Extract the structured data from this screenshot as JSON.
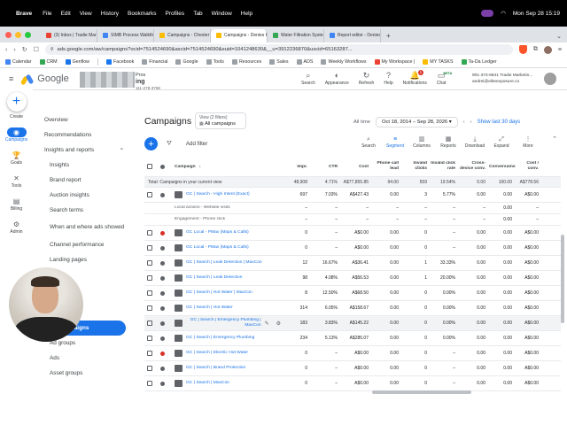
{
  "menubar": {
    "app": "Brave",
    "items": [
      "File",
      "Edit",
      "View",
      "History",
      "Bookmarks",
      "Profiles",
      "Tab",
      "Window",
      "Help"
    ],
    "clock": "Mon Sep 28  15:19"
  },
  "tabs": [
    {
      "label": "(3) Inbox | Tradie Marketing"
    },
    {
      "label": "SIMB Process Walkthrough"
    },
    {
      "label": "Campaigns - Chester Plumbing"
    },
    {
      "label": "Campaigns - Denies Plumbing"
    },
    {
      "label": "Water Filtration Systems Gold"
    },
    {
      "label": "Report editor - Denies Plumb"
    }
  ],
  "address": {
    "url": "ads.google.com/aw/campaigns?ocid=7514524690&ascid=7514524690&euid=1041248630&__u=3912236870&uscid=65163287..."
  },
  "bookmarks": [
    {
      "label": "Calendar",
      "color": "#4285f4"
    },
    {
      "label": "CRM",
      "color": "#34a853"
    },
    {
      "label": "Genflow",
      "color": "#1a73e8"
    },
    {
      "label": "Facebook",
      "color": "#1877f2"
    },
    {
      "label": "Financial",
      "color": "#9aa0a6"
    },
    {
      "label": "Google",
      "color": "#9aa0a6"
    },
    {
      "label": "Tools",
      "color": "#9aa0a6"
    },
    {
      "label": "Resources",
      "color": "#9aa0a6"
    },
    {
      "label": "Sales",
      "color": "#9aa0a6"
    },
    {
      "label": "ADS",
      "color": "#9aa0a6"
    },
    {
      "label": "Weekly Workflows",
      "color": "#9aa0a6"
    },
    {
      "label": "My Workspace |",
      "color": "#ea4335"
    },
    {
      "label": "MY TASKS",
      "color": "#fbbc04"
    },
    {
      "label": "Ta-Da Ledger",
      "color": "#34a853"
    }
  ],
  "header": {
    "brand": "Google",
    "account_line1": "Pros",
    "account_line2": "ing",
    "account_id": "111-278-3766",
    "tools": [
      {
        "label": "Search",
        "icon": "search-icon",
        "glyph": "⌕"
      },
      {
        "label": "Appearance",
        "icon": "appearance-icon",
        "glyph": "◐"
      },
      {
        "label": "Refresh",
        "icon": "refresh-icon",
        "glyph": "↻"
      },
      {
        "label": "Help",
        "icon": "help-icon",
        "glyph": "?"
      },
      {
        "label": "Notifications",
        "icon": "bell-icon",
        "glyph": "🔔",
        "badge": "1"
      },
      {
        "label": "Chat",
        "icon": "chat-icon",
        "glyph": "▭",
        "beta": "BETA"
      }
    ],
    "user_phone": "901-373-6841 Tradie Marketin...",
    "user_email": "andrei@eliteexposure.co"
  },
  "rail": [
    {
      "label": "Create",
      "glyph": "+"
    },
    {
      "label": "Campaigns",
      "glyph": "◉"
    },
    {
      "label": "Goals",
      "glyph": "🏆"
    },
    {
      "label": "Tools",
      "glyph": "✕"
    },
    {
      "label": "Billing",
      "glyph": "▤"
    },
    {
      "label": "Admin",
      "glyph": "⚙"
    }
  ],
  "nav": {
    "overview": "Overview",
    "recommendations": "Recommendations",
    "insights_group": "Insights and reports",
    "insights": "Insights",
    "brand_report": "Brand report",
    "auction_insights": "Auction insights",
    "search_terms": "Search terms",
    "when_where": "When and where ads showed",
    "channel_perf": "Channel performance",
    "landing_pages": "Landing pages",
    "campaigns_sel": "Campaigns",
    "ad_groups": "Ad groups",
    "ads": "Ads",
    "asset_groups": "Asset groups"
  },
  "main": {
    "title": "Campaigns",
    "view_filters": "View (2 filters)",
    "view_name": "All campaigns",
    "all_time": "All time",
    "date_range": "Oct 18, 2014 – Sep 28, 2026",
    "show_last": "Show last 30 days",
    "add_filter": "Add filter",
    "tools": [
      {
        "label": "Search",
        "glyph": "⌕"
      },
      {
        "label": "Segment",
        "glyph": "≡",
        "active": true
      },
      {
        "label": "Columns",
        "glyph": "▥"
      },
      {
        "label": "Reports",
        "glyph": "▦"
      },
      {
        "label": "Download",
        "glyph": "⤓"
      },
      {
        "label": "Expand",
        "glyph": "⤢"
      },
      {
        "label": "More",
        "glyph": "⋮"
      }
    ]
  },
  "table": {
    "headers": {
      "campaign": "Campaign",
      "impr": "Impr.",
      "ctr": "CTR",
      "cost": "Cost",
      "phone": "Phone call lead",
      "invalid": "Invalid clicks",
      "invalid_rate": "Invalid click rate",
      "cross": "Cross-device conv.",
      "conversions": "Conversions",
      "cost_conv": "Cost / conv."
    },
    "total": {
      "label": "Total: Campaigns in your current view",
      "impr": "48,908",
      "ctr": "4.71%",
      "cost": "A$77,855.85",
      "phone": "94.00",
      "invalid": "559",
      "invalid_rate": "19.54%",
      "cross": "0.00",
      "conversions": "100.00",
      "cost_conv": "A$778.56"
    },
    "rows": [
      {
        "name": "GC | Search - High Intent (Exact)",
        "status": "grey",
        "impr": "697",
        "ctr": "7.03%",
        "cost": "A$427.43",
        "phone": "0.00",
        "invalid": "3",
        "invalid_rate": "5.77%",
        "cross": "0.00",
        "conversions": "0.00",
        "cost_conv": "A$0.00"
      },
      {
        "name": "Local actions - Website visits",
        "sub": true,
        "impr": "–",
        "ctr": "–",
        "cost": "–",
        "phone": "–",
        "invalid": "–",
        "invalid_rate": "–",
        "cross": "–",
        "conversions": "0.00",
        "cost_conv": "–"
      },
      {
        "name": "Engagement - Phone click",
        "sub": true,
        "impr": "–",
        "ctr": "–",
        "cost": "–",
        "phone": "–",
        "invalid": "–",
        "invalid_rate": "–",
        "cross": "–",
        "conversions": "0.00",
        "cost_conv": "–"
      },
      {
        "name": "GC Local - PMax (Maps & Calls)",
        "status": "red",
        "impr": "0",
        "ctr": "–",
        "cost": "A$0.00",
        "phone": "0.00",
        "invalid": "0",
        "invalid_rate": "–",
        "cross": "0.00",
        "conversions": "0.00",
        "cost_conv": "A$0.00"
      },
      {
        "name": "GC Local - PMax (Maps & Calls)",
        "status": "grey",
        "impr": "0",
        "ctr": "–",
        "cost": "A$0.00",
        "phone": "0.00",
        "invalid": "0",
        "invalid_rate": "–",
        "cross": "0.00",
        "conversions": "0.00",
        "cost_conv": "A$0.00"
      },
      {
        "name": "GC | Search | Leak Detection | MaxCon",
        "status": "grey",
        "impr": "12",
        "ctr": "16.67%",
        "cost": "A$36.41",
        "phone": "0.00",
        "invalid": "1",
        "invalid_rate": "33.33%",
        "cross": "0.00",
        "conversions": "0.00",
        "cost_conv": "A$0.00"
      },
      {
        "name": "GC | Search | Leak Detection",
        "status": "grey",
        "impr": "98",
        "ctr": "4.08%",
        "cost": "A$56.53",
        "phone": "0.00",
        "invalid": "1",
        "invalid_rate": "20.00%",
        "cross": "0.00",
        "conversions": "0.00",
        "cost_conv": "A$0.00"
      },
      {
        "name": "GC | Search | Hot Water | MaxCon",
        "status": "grey",
        "impr": "8",
        "ctr": "12.50%",
        "cost": "A$68.50",
        "phone": "0.00",
        "invalid": "0",
        "invalid_rate": "0.00%",
        "cross": "0.00",
        "conversions": "0.00",
        "cost_conv": "A$0.00"
      },
      {
        "name": "GC | Search | Hot Water",
        "status": "grey",
        "impr": "314",
        "ctr": "6.05%",
        "cost": "A$158.67",
        "phone": "0.00",
        "invalid": "0",
        "invalid_rate": "0.00%",
        "cross": "0.00",
        "conversions": "0.00",
        "cost_conv": "A$0.00"
      },
      {
        "name": "GC | Search | Emergency Plumbing | MaxCon",
        "status": "grey",
        "impr": "183",
        "ctr": "3.83%",
        "cost": "A$145.22",
        "phone": "0.00",
        "invalid": "0",
        "invalid_rate": "0.00%",
        "cross": "0.00",
        "conversions": "0.00",
        "cost_conv": "A$0.00",
        "highlight": true
      },
      {
        "name": "GC | Search | Emergency Plumbing",
        "status": "grey",
        "impr": "234",
        "ctr": "5.13%",
        "cost": "A$285.07",
        "phone": "0.00",
        "invalid": "0",
        "invalid_rate": "0.00%",
        "cross": "0.00",
        "conversions": "0.00",
        "cost_conv": "A$0.00"
      },
      {
        "name": "GC | Search | Electric Hot Water",
        "status": "red",
        "impr": "0",
        "ctr": "–",
        "cost": "A$0.00",
        "phone": "0.00",
        "invalid": "0",
        "invalid_rate": "–",
        "cross": "0.00",
        "conversions": "0.00",
        "cost_conv": "A$0.00"
      },
      {
        "name": "GC | Search | Brand Protection",
        "status": "grey",
        "impr": "0",
        "ctr": "–",
        "cost": "A$0.00",
        "phone": "0.00",
        "invalid": "0",
        "invalid_rate": "–",
        "cross": "0.00",
        "conversions": "0.00",
        "cost_conv": "A$0.00"
      },
      {
        "name": "GC | Search | MaxCon",
        "status": "grey",
        "impr": "0",
        "ctr": "–",
        "cost": "A$0.00",
        "phone": "0.00",
        "invalid": "0",
        "invalid_rate": "–",
        "cross": "0.00",
        "conversions": "0.00",
        "cost_conv": "A$0.00"
      }
    ]
  }
}
